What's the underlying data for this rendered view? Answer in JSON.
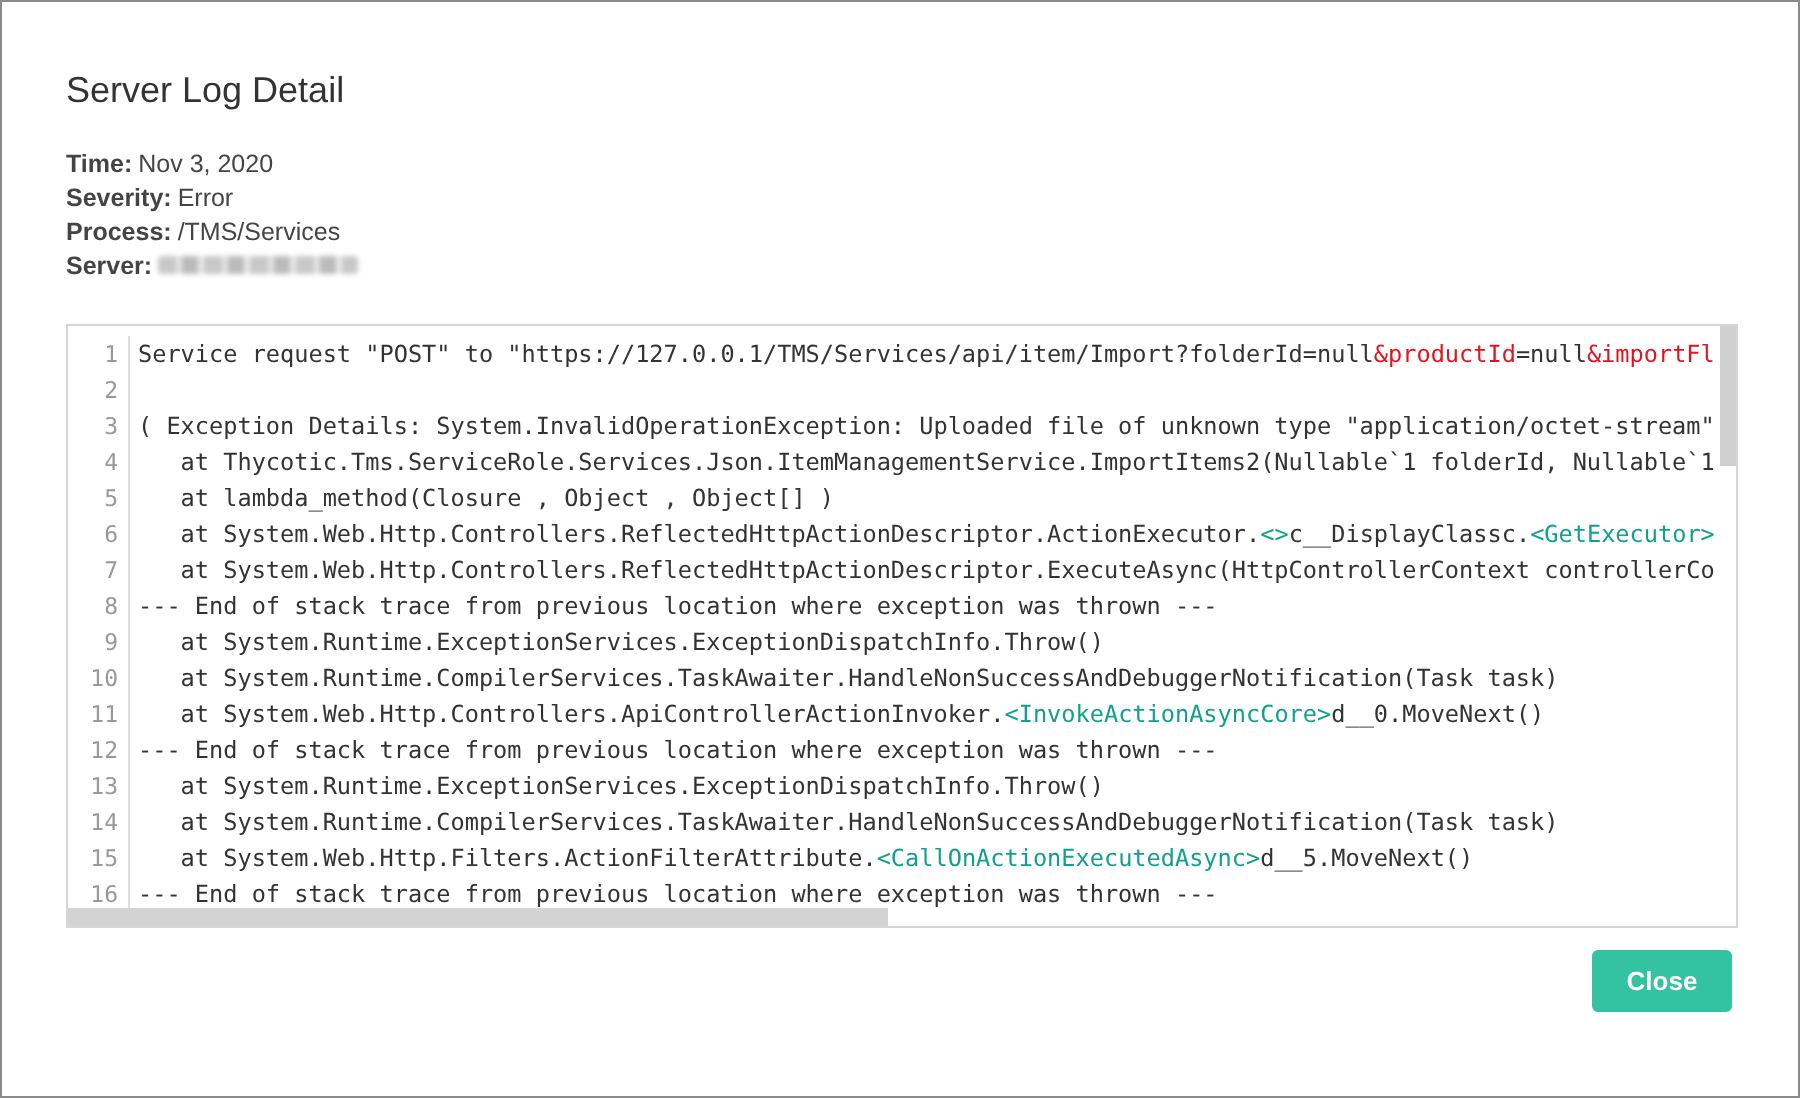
{
  "dialog": {
    "title": "Server Log Detail"
  },
  "details": [
    {
      "kind": "text",
      "label": "Time:",
      "value": "Nov 3, 2020"
    },
    {
      "kind": "text",
      "label": "Severity:",
      "value": "Error"
    },
    {
      "kind": "text",
      "label": "Process:",
      "value": "/TMS/Services"
    },
    {
      "kind": "redacted",
      "label": "Server:"
    }
  ],
  "log_lines": [
    {
      "number": "1",
      "segments": [
        {
          "kind": "plain",
          "text": "Service request \"POST\" to \"https://127.0.0.1/TMS/Services/api/item/Import?folderId=null"
        },
        {
          "kind": "param",
          "text": "&productId"
        },
        {
          "kind": "plain",
          "text": "=null"
        },
        {
          "kind": "param",
          "text": "&importFl"
        }
      ]
    },
    {
      "number": "2"
    },
    {
      "number": "3",
      "segments": [
        {
          "kind": "plain",
          "text": "( Exception Details: System.InvalidOperationException: Uploaded file of unknown type \"application/octet-stream\""
        }
      ]
    },
    {
      "number": "4",
      "segments": [
        {
          "kind": "plain",
          "text": "   at Thycotic.Tms.ServiceRole.Services.Json.ItemManagementService.ImportItems2(Nullable`1 folderId, Nullable`1"
        }
      ]
    },
    {
      "number": "5",
      "segments": [
        {
          "kind": "plain",
          "text": "   at lambda_method(Closure , Object , Object[] )"
        }
      ]
    },
    {
      "number": "6",
      "segments": [
        {
          "kind": "plain",
          "text": "   at System.Web.Http.Controllers.ReflectedHttpActionDescriptor.ActionExecutor."
        },
        {
          "kind": "tag",
          "text": "<>"
        },
        {
          "kind": "plain",
          "text": "c__DisplayClassc."
        },
        {
          "kind": "tag",
          "text": "<GetExecutor>"
        }
      ]
    },
    {
      "number": "7",
      "segments": [
        {
          "kind": "plain",
          "text": "   at System.Web.Http.Controllers.ReflectedHttpActionDescriptor.ExecuteAsync(HttpControllerContext controllerCo"
        }
      ]
    },
    {
      "number": "8",
      "segments": [
        {
          "kind": "plain",
          "text": "--- End of stack trace from previous location where exception was thrown ---"
        }
      ]
    },
    {
      "number": "9",
      "segments": [
        {
          "kind": "plain",
          "text": "   at System.Runtime.ExceptionServices.ExceptionDispatchInfo.Throw()"
        }
      ]
    },
    {
      "number": "10",
      "segments": [
        {
          "kind": "plain",
          "text": "   at System.Runtime.CompilerServices.TaskAwaiter.HandleNonSuccessAndDebuggerNotification(Task task)"
        }
      ]
    },
    {
      "number": "11",
      "segments": [
        {
          "kind": "plain",
          "text": "   at System.Web.Http.Controllers.ApiControllerActionInvoker."
        },
        {
          "kind": "tag",
          "text": "<InvokeActionAsyncCore>"
        },
        {
          "kind": "plain",
          "text": "d__0.MoveNext()"
        }
      ]
    },
    {
      "number": "12",
      "segments": [
        {
          "kind": "plain",
          "text": "--- End of stack trace from previous location where exception was thrown ---"
        }
      ]
    },
    {
      "number": "13",
      "segments": [
        {
          "kind": "plain",
          "text": "   at System.Runtime.ExceptionServices.ExceptionDispatchInfo.Throw()"
        }
      ]
    },
    {
      "number": "14",
      "segments": [
        {
          "kind": "plain",
          "text": "   at System.Runtime.CompilerServices.TaskAwaiter.HandleNonSuccessAndDebuggerNotification(Task task)"
        }
      ]
    },
    {
      "number": "15",
      "segments": [
        {
          "kind": "plain",
          "text": "   at System.Web.Http.Filters.ActionFilterAttribute."
        },
        {
          "kind": "tag",
          "text": "<CallOnActionExecutedAsync>"
        },
        {
          "kind": "plain",
          "text": "d__5.MoveNext()"
        }
      ]
    },
    {
      "number": "16",
      "segments": [
        {
          "kind": "plain",
          "text": "--- End of stack trace from previous location where exception was thrown ---"
        }
      ]
    }
  ],
  "buttons": [
    {
      "label": "Close"
    }
  ]
}
